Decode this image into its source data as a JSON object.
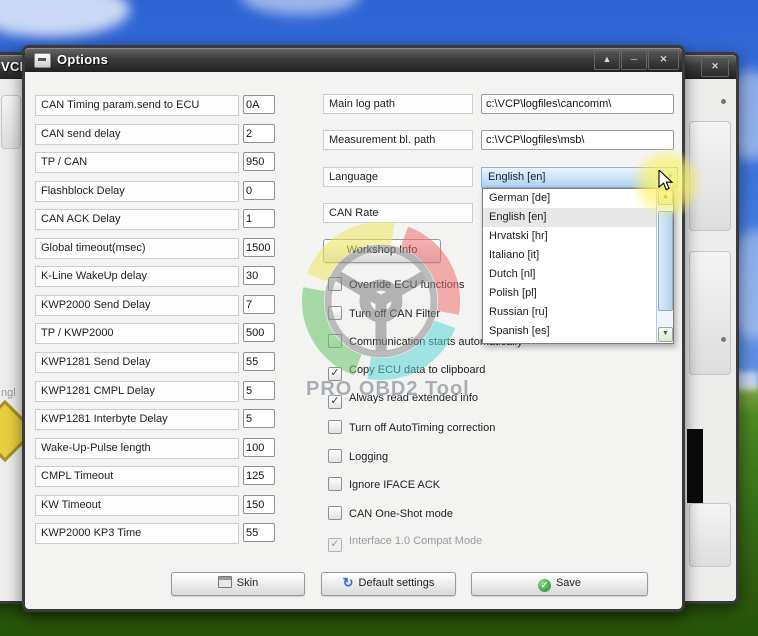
{
  "window": {
    "title": "Options",
    "maximize_glyph": "▲",
    "minimize_glyph": "─",
    "close_glyph": "✕"
  },
  "background_window": {
    "title_fragment": "VCP",
    "close_glyph": "✕",
    "left_text_fragment": "ngl"
  },
  "left_params": [
    {
      "label": "CAN Timing param.send to ECU",
      "value": "0A"
    },
    {
      "label": "CAN send delay",
      "value": "2"
    },
    {
      "label": "TP / CAN",
      "value": "950"
    },
    {
      "label": "Flashblock Delay",
      "value": "0"
    },
    {
      "label": "CAN ACK Delay",
      "value": "1"
    },
    {
      "label": "Global timeout(msec)",
      "value": "1500"
    },
    {
      "label": "K-Line WakeUp delay",
      "value": "30"
    },
    {
      "label": "KWP2000 Send Delay",
      "value": "7"
    },
    {
      "label": "TP / KWP2000",
      "value": "500"
    },
    {
      "label": "KWP1281 Send Delay",
      "value": "55"
    },
    {
      "label": "KWP1281 CMPL Delay",
      "value": "5"
    },
    {
      "label": "KWP1281 Interbyte Delay",
      "value": "5"
    },
    {
      "label": "Wake-Up-Pulse length",
      "value": "100"
    },
    {
      "label": "CMPL Timeout",
      "value": "125"
    },
    {
      "label": "KW Timeout",
      "value": "150"
    },
    {
      "label": "KWP2000 KP3 Time",
      "value": "55"
    }
  ],
  "right": {
    "fields": [
      {
        "label": "Main log path",
        "value": "c:\\VCP\\logfiles\\cancomm\\"
      },
      {
        "label": "Measurement bl. path",
        "value": "c:\\VCP\\logfiles\\msb\\"
      }
    ],
    "language": {
      "label": "Language",
      "selected": "English [en]"
    },
    "can_rate": {
      "label": "CAN Rate"
    },
    "dropdown": {
      "items": [
        "German [de]",
        "English [en]",
        "Hrvatski [hr]",
        "Italiano [it]",
        "Dutch [nl]",
        "Polish [pl]",
        "Russian [ru]",
        "Spanish [es]"
      ],
      "selected_index": 1
    },
    "workshop_button": "Workshop Info",
    "checkboxes": [
      {
        "label": "Override ECU functions",
        "checked": false,
        "disabled": false
      },
      {
        "label": "Turn off CAN Filter",
        "checked": false,
        "disabled": false
      },
      {
        "label": "Communication starts automatically",
        "checked": false,
        "disabled": false
      },
      {
        "label": "Copy ECU data to clipboard",
        "checked": true,
        "disabled": false
      },
      {
        "label": "Always read extended info",
        "checked": true,
        "disabled": false
      },
      {
        "label": "Turn off AutoTiming correction",
        "checked": false,
        "disabled": false
      },
      {
        "label": "Logging",
        "checked": false,
        "disabled": false
      },
      {
        "label": "Ignore IFACE ACK",
        "checked": false,
        "disabled": false
      },
      {
        "label": "CAN One-Shot mode",
        "checked": false,
        "disabled": false
      },
      {
        "label": "Interface 1.0 Compat Mode",
        "checked": true,
        "disabled": true
      }
    ]
  },
  "footer": {
    "skin_label": "Skin",
    "defaults_label": "Default settings",
    "save_label": "Save"
  },
  "watermark": {
    "text": "PRO OBD2 Tool"
  },
  "icons": {
    "combo_arrow": "▼",
    "scroll_up": "▲",
    "scroll_down": "▼",
    "check": "✓",
    "reset_arrow": "↻"
  },
  "colors": {
    "selection_blue": "#bcd9f1",
    "save_green": "#3da044",
    "defaults_blue": "#2f6fd0",
    "glow_yellow": "#faf26e",
    "ring_yellow": "#efe95e",
    "ring_red": "#ef6f6f",
    "ring_cyan": "#5cd6d6",
    "ring_green": "#69c569"
  }
}
